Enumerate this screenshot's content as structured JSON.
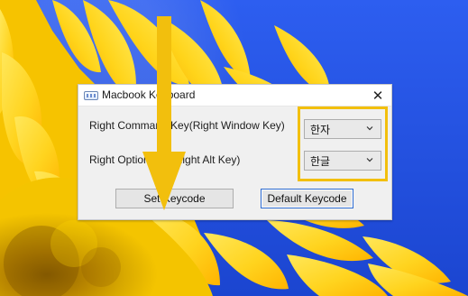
{
  "desktop": {
    "background_name": "sunflower-blue-sky"
  },
  "dialog": {
    "title": "Macbook Keyboard",
    "close_symbol": "✕",
    "rows": [
      {
        "label": "Right Command Key(Right Window Key)",
        "selected_value": "한자"
      },
      {
        "label": "Right Option Key(Right Alt Key)",
        "selected_value": "한글"
      }
    ],
    "buttons": {
      "set_keycode": "Set Keycode",
      "default_keycode": "Default Keycode"
    }
  },
  "annotation": {
    "color": "#f2bf0d",
    "arrow_icon": "down-arrow-icon",
    "highlight_icon": "highlight-box-icon"
  },
  "icons": {
    "window": "keyboard-icon",
    "close": "close-icon",
    "dropdown": "chevron-down-icon"
  }
}
